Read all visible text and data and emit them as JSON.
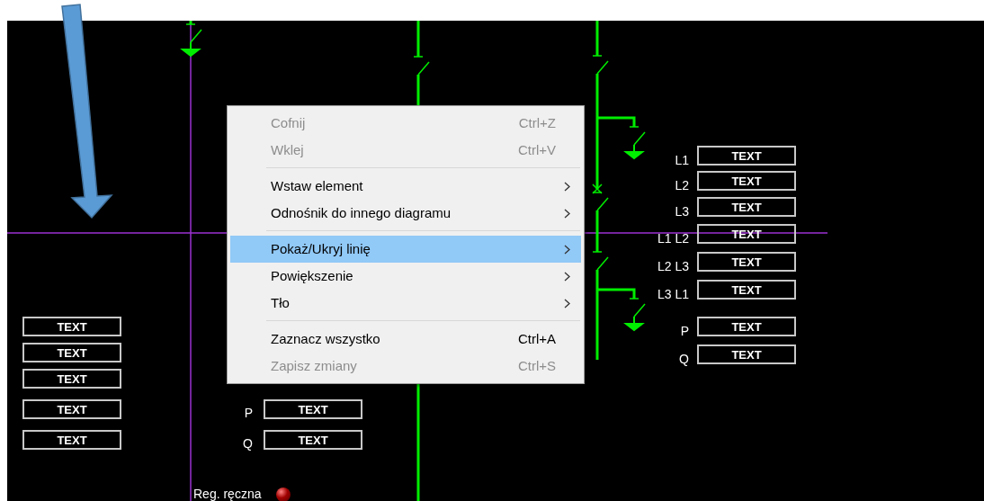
{
  "diagram": {
    "right_readouts": [
      {
        "label": "L1",
        "value": "TEXT"
      },
      {
        "label": "L2",
        "value": "TEXT"
      },
      {
        "label": "L3",
        "value": "TEXT"
      },
      {
        "label": "L1 L2",
        "value": "TEXT"
      },
      {
        "label": "L2 L3",
        "value": "TEXT"
      },
      {
        "label": "L3 L1",
        "value": "TEXT"
      },
      {
        "label": "P",
        "value": "TEXT"
      },
      {
        "label": "Q",
        "value": "TEXT"
      }
    ],
    "left_readouts": [
      {
        "value": "TEXT"
      },
      {
        "value": "TEXT"
      },
      {
        "value": "TEXT"
      },
      {
        "value": "TEXT"
      },
      {
        "value": "TEXT"
      }
    ],
    "middle_readouts": [
      {
        "label": "P",
        "value": "TEXT"
      },
      {
        "label": "Q",
        "value": "TEXT"
      }
    ],
    "status": {
      "label": "Reg. ręczna"
    }
  },
  "context_menu": {
    "groups": [
      {
        "items": [
          {
            "label": "Cofnij",
            "shortcut": "Ctrl+Z",
            "disabled": true,
            "selected": false,
            "submenu": false
          },
          {
            "label": "Wklej",
            "shortcut": "Ctrl+V",
            "disabled": true,
            "selected": false,
            "submenu": false
          }
        ]
      },
      {
        "items": [
          {
            "label": "Wstaw element",
            "disabled": false,
            "selected": false,
            "submenu": true
          },
          {
            "label": "Odnośnik do innego diagramu",
            "disabled": false,
            "selected": false,
            "submenu": true
          }
        ]
      },
      {
        "items": [
          {
            "label": "Pokaż/Ukryj linię",
            "disabled": false,
            "selected": true,
            "submenu": true
          },
          {
            "label": "Powiększenie",
            "disabled": false,
            "selected": false,
            "submenu": true
          },
          {
            "label": "Tło",
            "disabled": false,
            "selected": false,
            "submenu": true
          }
        ]
      },
      {
        "items": [
          {
            "label": "Zaznacz wszystko",
            "shortcut": "Ctrl+A",
            "disabled": false,
            "selected": false,
            "submenu": false
          },
          {
            "label": "Zapisz zmiany",
            "shortcut": "Ctrl+S",
            "disabled": true,
            "selected": false,
            "submenu": false
          }
        ]
      }
    ]
  }
}
